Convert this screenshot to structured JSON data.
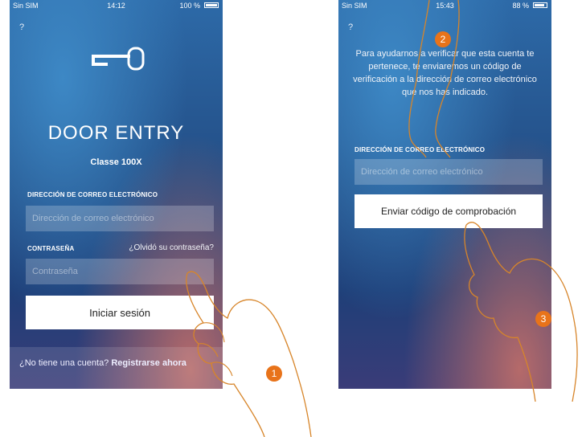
{
  "phone1": {
    "status": {
      "carrier": "Sin SIM",
      "time": "14:12",
      "battery": "100 %"
    },
    "help": "?",
    "title": "DOOR ENTRY",
    "subtitle": "Classe 100X",
    "email_label": "DIRECCIÓN DE CORREO ELECTRÓNICO",
    "email_placeholder": "Dirección de correo electrónico",
    "password_label": "CONTRASEÑA",
    "forgot_link": "¿Olvidó su contraseña?",
    "password_placeholder": "Contraseña",
    "login_button": "Iniciar sesión",
    "footer_text": "¿No tiene una cuenta? ",
    "footer_link": "Registrarse ahora"
  },
  "phone2": {
    "status": {
      "carrier": "Sin SIM",
      "time": "15:43",
      "battery": "88 %"
    },
    "help": "?",
    "info": "Para ayudarnos a verificar que esta cuenta te pertenece, te enviaremos un código de verificación a la dirección de correo electrónico que nos has indicado.",
    "email_label": "DIRECCIÓN DE CORREO ELECTRÓNICO",
    "email_placeholder": "Dirección de correo electrónico",
    "send_button": "Enviar código de comprobación"
  },
  "steps": [
    "1",
    "2",
    "3"
  ],
  "colors": {
    "accent": "#e8731a",
    "background": "#2a5e9c"
  }
}
